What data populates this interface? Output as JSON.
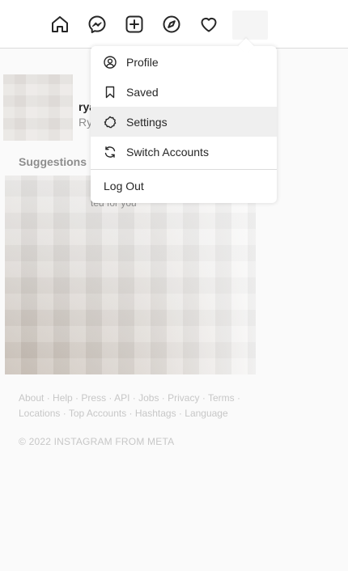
{
  "nav": {
    "icons": [
      "home-icon",
      "messenger-icon",
      "new-post-icon",
      "explore-icon",
      "activity-heart-icon"
    ]
  },
  "profile": {
    "username": "rya",
    "fullname": "Ry"
  },
  "suggestions": {
    "title": "Suggestions",
    "subtitle": "ted for you"
  },
  "menu": {
    "items": [
      {
        "label": "Profile",
        "icon": "profile-icon"
      },
      {
        "label": "Saved",
        "icon": "bookmark-icon"
      },
      {
        "label": "Settings",
        "icon": "settings-icon",
        "active": true
      },
      {
        "label": "Switch Accounts",
        "icon": "switch-accounts-icon"
      }
    ],
    "logout": "Log Out"
  },
  "footer": {
    "links": [
      "About",
      "Help",
      "Press",
      "API",
      "Jobs",
      "Privacy",
      "Terms",
      "Locations",
      "Top Accounts",
      "Hashtags",
      "Language"
    ],
    "copyright": "© 2022 INSTAGRAM FROM META"
  }
}
